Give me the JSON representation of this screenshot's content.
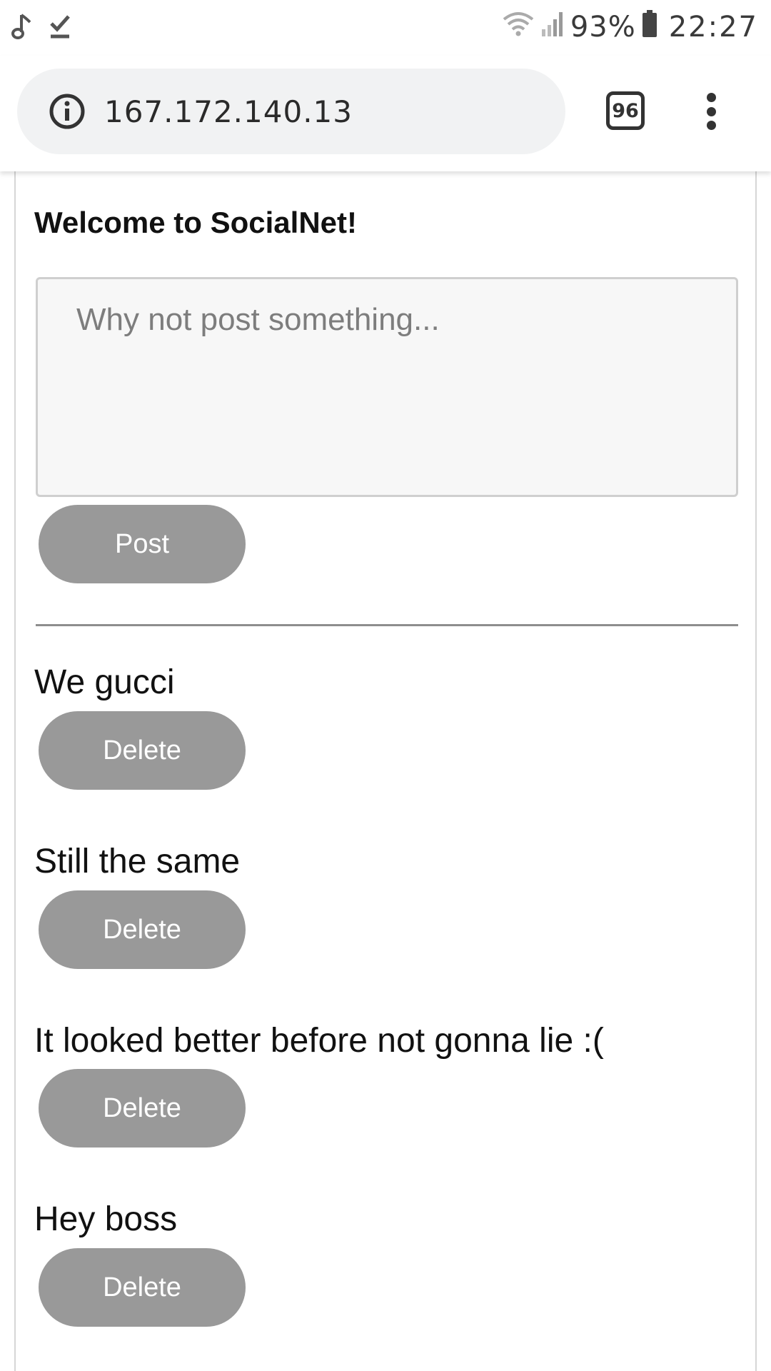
{
  "status_bar": {
    "icons_left": [
      "music-note-icon",
      "download-done-icon"
    ],
    "icons_right": [
      "wifi-icon",
      "signal-icon",
      "battery-icon"
    ],
    "battery": "93%",
    "time": "22:27"
  },
  "browser": {
    "url": "167.172.140.13",
    "tab_count": "96",
    "icons": [
      "info-icon",
      "menu-icon"
    ]
  },
  "page": {
    "title": "Welcome to SocialNet!",
    "composer": {
      "placeholder": "Why not post something...",
      "value": ""
    },
    "post_button": "Post",
    "posts": [
      {
        "text": "We gucci",
        "delete_label": "Delete"
      },
      {
        "text": "Still the same",
        "delete_label": "Delete"
      },
      {
        "text": "It looked better before not gonna lie :(",
        "delete_label": "Delete"
      },
      {
        "text": "Hey boss",
        "delete_label": "Delete"
      }
    ]
  },
  "colors": {
    "button_bg": "#999999",
    "button_text": "#ffffff",
    "url_pill_bg": "#f1f2f3",
    "textarea_bg": "#f7f7f7"
  }
}
